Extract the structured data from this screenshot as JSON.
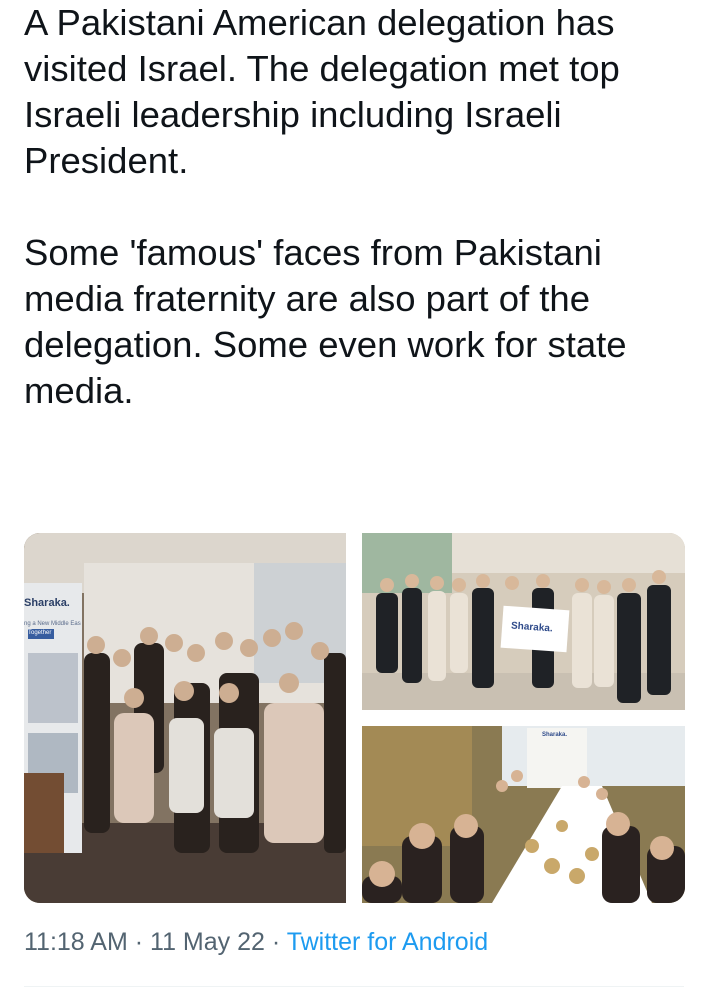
{
  "tweet": {
    "text_paragraph_1": "A Pakistani American delegation has visited Israel. The delegation met top Israeli leadership including Israeli President.",
    "text_paragraph_2": "Some 'famous' faces from Pakistani media fraternity are also part of the delegation. Some even work for state media.",
    "time": "11:18 AM",
    "separator": "·",
    "date": "11 May 22",
    "source": "Twitter for Android"
  },
  "media": {
    "photo_1": {
      "banner_title": "Sharaka.",
      "banner_subtitle": "ng a New Middle Eas",
      "banner_tag": "Together"
    },
    "photo_2": {
      "banner_title": "Sharaka."
    },
    "photo_3": {
      "banner_title": "Sharaka."
    }
  },
  "colors": {
    "text": "#0f1419",
    "meta": "#536471",
    "link": "#1d9bf0"
  }
}
